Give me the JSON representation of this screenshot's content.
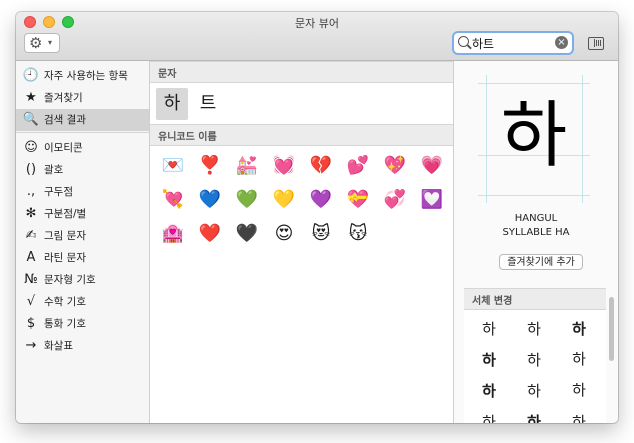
{
  "window": {
    "title": "문자 뷰어"
  },
  "toolbar": {
    "gear_icon": "gear-icon",
    "chevron": "chevron-down-icon"
  },
  "search": {
    "value": "하트",
    "clear_icon": "clear-icon"
  },
  "sidebar": {
    "items": [
      {
        "icon": "🕘",
        "label": "자주 사용하는 항목"
      },
      {
        "icon": "★",
        "label": "즐겨찾기"
      },
      {
        "icon": "🔍",
        "label": "검색 결과"
      },
      {
        "icon": "☺",
        "label": "이모티콘"
      },
      {
        "icon": "()",
        "label": "괄호"
      },
      {
        "icon": ".,",
        "label": "구두점"
      },
      {
        "icon": "✻",
        "label": "구분점/별"
      },
      {
        "icon": "✍",
        "label": "그림 문자"
      },
      {
        "icon": "A",
        "label": "라틴 문자"
      },
      {
        "icon": "№",
        "label": "문자형 기호"
      },
      {
        "icon": "√",
        "label": "수학 기호"
      },
      {
        "icon": "$",
        "label": "통화 기호"
      },
      {
        "icon": "→",
        "label": "화살표"
      }
    ]
  },
  "main": {
    "section1": "문자",
    "glyphs": [
      "하",
      "트"
    ],
    "section2": "유니코드 이름",
    "emojis": [
      "💌",
      "❣️",
      "💒",
      "💓",
      "💔",
      "💕",
      "💖",
      "💗",
      "💘",
      "💙",
      "💚",
      "💛",
      "💜",
      "💝",
      "💞",
      "💟",
      "🏩",
      "❤️",
      "🖤",
      "😍",
      "😻",
      "😽"
    ]
  },
  "detail": {
    "char": "하",
    "name1": "HANGUL",
    "name2": "SYLLABLE HA",
    "fav_button": "즐겨찾기에 추가",
    "font_section": "서체 변경",
    "variants": [
      "하",
      "하",
      "하",
      "하",
      "하",
      "하",
      "하",
      "하",
      "하",
      "하",
      "하",
      "하"
    ]
  }
}
